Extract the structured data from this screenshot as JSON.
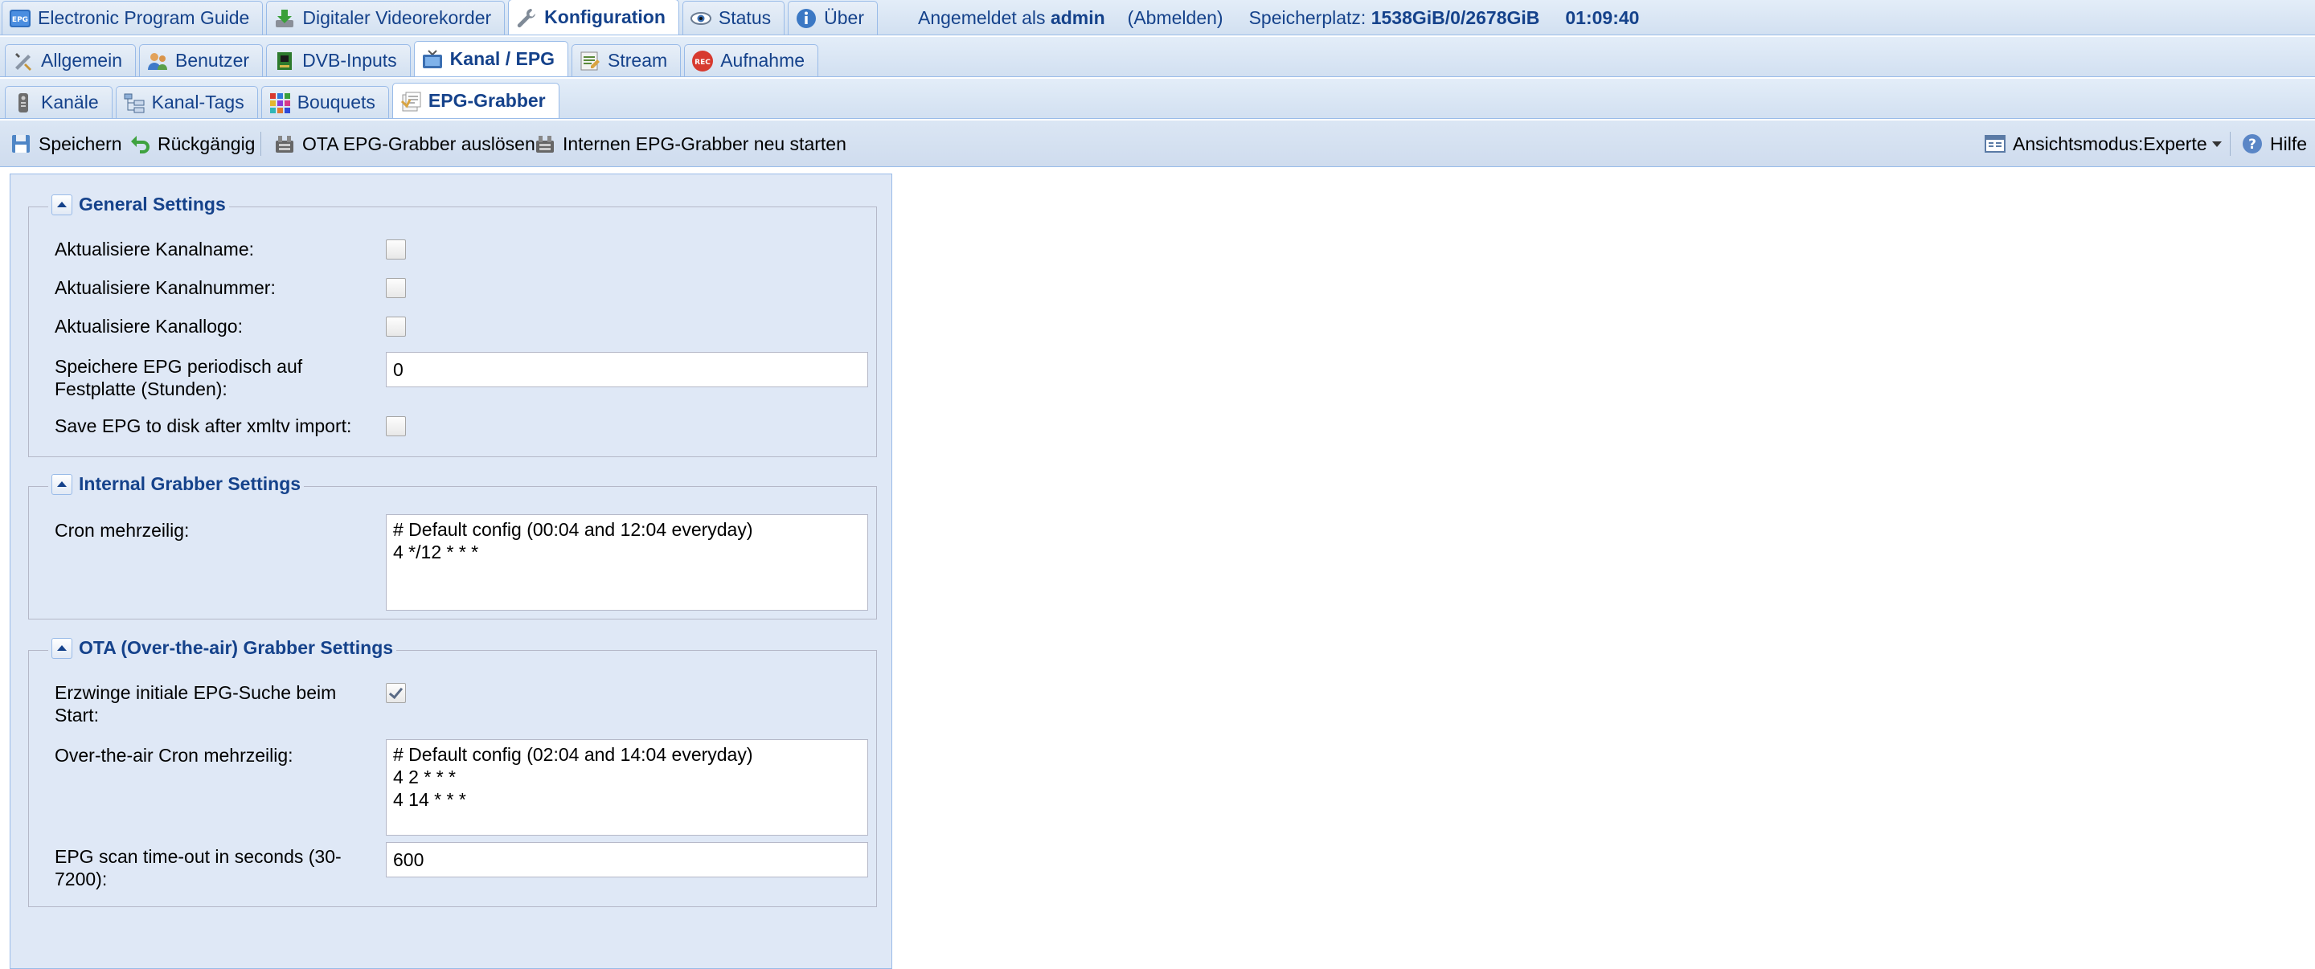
{
  "main_tabs": [
    {
      "label": "Electronic Program Guide",
      "icon": "epg-icon"
    },
    {
      "label": "Digitaler Videorekorder",
      "icon": "download-icon"
    },
    {
      "label": "Konfiguration",
      "icon": "wrench-icon",
      "active": true
    },
    {
      "label": "Status",
      "icon": "eye-icon"
    },
    {
      "label": "Über",
      "icon": "info-icon"
    }
  ],
  "status": {
    "logged_in_prefix": "Angemeldet als ",
    "username": "admin",
    "logout": "(Abmelden)",
    "storage_prefix": "Speicherplatz: ",
    "storage_value": "1538GiB/0/2678GiB",
    "time": "01:09:40"
  },
  "config_tabs": [
    {
      "label": "Allgemein",
      "icon": "tools-icon"
    },
    {
      "label": "Benutzer",
      "icon": "users-icon"
    },
    {
      "label": "DVB-Inputs",
      "icon": "card-icon"
    },
    {
      "label": "Kanal / EPG",
      "icon": "tv-icon",
      "active": true
    },
    {
      "label": "Stream",
      "icon": "stream-icon"
    },
    {
      "label": "Aufnahme",
      "icon": "rec-icon"
    }
  ],
  "channel_tabs": [
    {
      "label": "Kanäle",
      "icon": "remote-icon"
    },
    {
      "label": "Kanal-Tags",
      "icon": "tree-icon"
    },
    {
      "label": "Bouquets",
      "icon": "grid-icon"
    },
    {
      "label": "EPG-Grabber",
      "icon": "grabber-icon",
      "active": true
    }
  ],
  "toolbar": {
    "save": "Speichern",
    "undo": "Rückgängig",
    "ota_trigger": "OTA EPG-Grabber auslösen",
    "restart_internal": "Internen EPG-Grabber neu starten",
    "view_mode": "Ansichtsmodus:Experte",
    "help": "Hilfe"
  },
  "general": {
    "title": "General Settings",
    "update_name_label": "Aktualisiere Kanalname:",
    "update_name": false,
    "update_number_label": "Aktualisiere Kanalnummer:",
    "update_number": false,
    "update_logo_label": "Aktualisiere Kanallogo:",
    "update_logo": false,
    "periodic_save_label_1": "Speichere EPG periodisch auf",
    "periodic_save_label_2": "Festplatte (Stunden):",
    "periodic_save_value": "0",
    "save_after_xmltv_label": "Save EPG to disk after xmltv import:",
    "save_after_xmltv": false
  },
  "internal": {
    "title": "Internal Grabber Settings",
    "cron_label": "Cron mehrzeilig:",
    "cron_value": "# Default config (00:04 and 12:04 everyday)\n4 */12 * * *"
  },
  "ota": {
    "title": "OTA (Over-the-air) Grabber Settings",
    "force_initial_label_1": "Erzwinge initiale EPG-Suche beim",
    "force_initial_label_2": "Start:",
    "force_initial": true,
    "cron_label": "Over-the-air Cron mehrzeilig:",
    "cron_value": "# Default config (02:04 and 14:04 everyday)\n4 2 * * *\n4 14 * * *",
    "timeout_label_1": "EPG scan time-out in seconds (30-",
    "timeout_label_2": "7200):",
    "timeout_value": "600"
  }
}
